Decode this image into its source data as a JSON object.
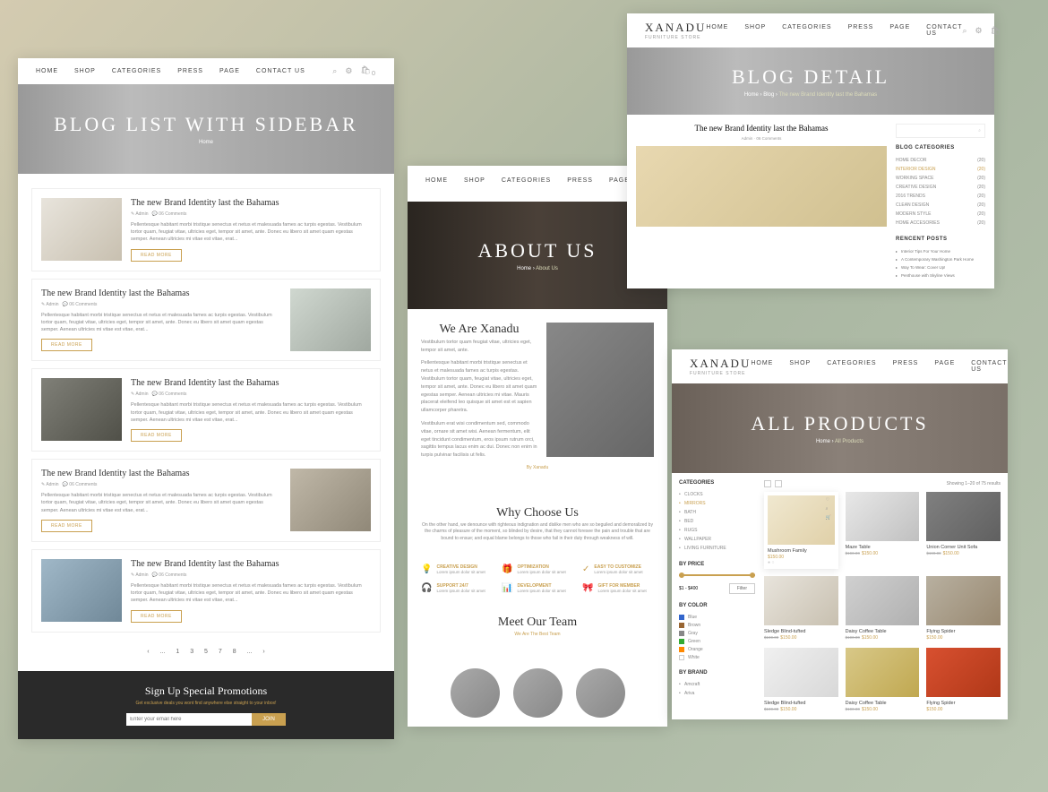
{
  "brand": {
    "name": "XANADU",
    "tagline": "FURNITURE STORE"
  },
  "nav": {
    "home": "HOME",
    "shop": "SHOP",
    "categories": "CATEGORIES",
    "press": "PRESS",
    "page": "PAGE",
    "contact": "CONTACT US",
    "cart_count": "0"
  },
  "p1": {
    "title": "BLOG LIST WITH SIDEBAR",
    "crumb_home": "Home",
    "posts": [
      {
        "title": "The new Brand Identity last the Bahamas",
        "author": "Admin",
        "comments": "06 Comments",
        "excerpt": "Pellentesque habitant morbi tristique senectus et netus et malesuada fames ac turpis egestas. Vestibulum tortor quam, feugiat vitae, ultricies eget, tempor sit amet, ante. Donec eu libero sit amet quam egestas semper. Aenean ultricies mi vitae est vitae, erat...",
        "btn": "READ MORE"
      },
      {
        "title": "The new Brand Identity last the Bahamas",
        "author": "Admin",
        "comments": "06 Comments",
        "excerpt": "Pellentesque habitant morbi tristique senectus et netus et malesuada fames ac turpis egestas. Vestibulum tortor quam, feugiat vitae, ultricies eget, tempor sit amet, ante. Donec eu libero sit amet quam egestas semper. Aenean ultricies mi vitae est vitae, erat...",
        "btn": "READ MORE"
      },
      {
        "title": "The new Brand Identity last the Bahamas",
        "author": "Admin",
        "comments": "06 Comments",
        "excerpt": "Pellentesque habitant morbi tristique senectus et netus et malesuada fames ac turpis egestas. Vestibulum tortor quam, feugiat vitae, ultricies eget, tempor sit amet, ante. Donec eu libero sit amet quam egestas semper. Aenean ultricies mi vitae est vitae, erat...",
        "btn": "READ MORE"
      },
      {
        "title": "The new Brand Identity last the Bahamas",
        "author": "Admin",
        "comments": "06 Comments",
        "excerpt": "Pellentesque habitant morbi tristique senectus et netus et malesuada fames ac turpis egestas. Vestibulum tortor quam, feugiat vitae, ultricies eget, tempor sit amet, ante. Donec eu libero sit amet quam egestas semper. Aenean ultricies mi vitae est vitae, erat...",
        "btn": "READ MORE"
      },
      {
        "title": "The new Brand Identity last the Bahamas",
        "author": "Admin",
        "comments": "06 Comments",
        "excerpt": "Pellentesque habitant morbi tristique senectus et netus et malesuada fames ac turpis egestas. Vestibulum tortor quam, feugiat vitae, ultricies eget, tempor sit amet, ante. Donec eu libero sit amet quam egestas semper. Aenean ultricies mi vitae est vitae, erat...",
        "btn": "READ MORE"
      }
    ],
    "pagination": {
      "prev": "‹",
      "dots": "...",
      "p1": "1",
      "p3": "3",
      "p5": "5",
      "p7": "7",
      "p8": "8",
      "next": "›"
    },
    "signup": {
      "title": "Sign Up Special Promotions",
      "sub": "Get exclusive deals you wont find anywhere else straight to your inbox!",
      "placeholder": "Enter your email here",
      "btn": "JOIN"
    }
  },
  "p2": {
    "title": "ABOUT US",
    "crumb": {
      "home": "Home",
      "current": "About Us"
    },
    "about": {
      "title": "We Are Xanadu",
      "sub": "By Xanadu",
      "text1": "Vestibulum tortor quam feugiat vitae, ultricies eget, tempor sit amet, ante.",
      "text2": "Pellentesque habitant morbi tristique senectus et netus et malesuada fames ac turpis egestas. Vestibulum tortor quam, feugiat vitae, ultricies eget, tempor sit amet, ante. Donec eu libero sit amet quam egestas semper. Aenean ultricies mi vitae. Mauris placerat eleifend leo quisque sit amet est et sapien ullamcorper pharetra.",
      "text3": "Vestibulum erat wisi condimentum sed, commodo vitae, ornare sit amet wisi. Aenean fermentum, elit eget tincidunt condimentum, eros ipsum rutrum orci, sagittis tempus lacus enim ac dui. Donec non enim in turpis pulvinar facilisis ut felis."
    },
    "why": {
      "title": "Why Choose Us",
      "sub": "On the other hand, we denounce with righteous indignation and dislike men who are so beguiled and demoralized by the charms of pleasure of the moment, so blinded by desire, that they cannot foresee the pain and trouble that are bound to ensue; and equal blame belongs to those who fail in their duty through weakness of will."
    },
    "features": [
      {
        "title": "CREATIVE DESIGN",
        "desc": "Lorem ipsum dolor sit amet"
      },
      {
        "title": "OPTIMIZATION",
        "desc": "Lorem ipsum dolor sit amet"
      },
      {
        "title": "EASY TO CUSTOMIZE",
        "desc": "Lorem ipsum dolor sit amet"
      },
      {
        "title": "SUPPORT 24/7",
        "desc": "Lorem ipsum dolor sit amet"
      },
      {
        "title": "DEVELOPMENT",
        "desc": "Lorem ipsum dolor sit amet"
      },
      {
        "title": "GIFT FOR MEMBER",
        "desc": "Lorem ipsum dolor sit amet"
      }
    ],
    "team": {
      "title": "Meet Our Team",
      "sub": "We Are The Best Team"
    }
  },
  "p3": {
    "title": "BLOG DETAIL",
    "crumb": {
      "home": "Home",
      "blog": "Blog",
      "current": "The new Brand Identity last the Bahamas"
    },
    "post": {
      "title": "The new Brand Identity last the Bahamas",
      "meta": "Admin · 06 Comments"
    },
    "side": {
      "cat_title": "BLOG CATEGORIES",
      "cats": [
        {
          "name": "HOME DECOR",
          "count": "(20)"
        },
        {
          "name": "INTERIOR DESIGN",
          "count": "(20)"
        },
        {
          "name": "WORKING SPACE",
          "count": "(20)"
        },
        {
          "name": "CREATIVE DESIGN",
          "count": "(20)"
        },
        {
          "name": "2016 TRENDS",
          "count": "(20)"
        },
        {
          "name": "CLEAN DESIGN",
          "count": "(20)"
        },
        {
          "name": "MODERN STYLE",
          "count": "(20)"
        },
        {
          "name": "HOME ACCESORIES",
          "count": "(20)"
        }
      ],
      "recent_title": "RENCENT POSTS",
      "recent": [
        "Interior Tips For Your Home",
        "A Contemporary Washington Park Home",
        "Way To Wear: Cover Up!",
        "Penthouse with Skyline Views"
      ]
    }
  },
  "p4": {
    "title": "ALL PRODUCTS",
    "crumb": {
      "home": "Home",
      "current": "All Products"
    },
    "side": {
      "cat_title": "CATEGORIES",
      "cats": [
        "CLOCKS",
        "MIRRORS",
        "BATH",
        "BED",
        "RUGS",
        "WALLPAPER",
        "LIVING FURNITURE"
      ],
      "price_title": "BY PRICE",
      "price_range": "$1 - $400",
      "filter_btn": "Filter",
      "color_title": "BY COLOR",
      "colors": [
        "Blue",
        "Brown",
        "Gray",
        "Green",
        "Orange",
        "White"
      ],
      "brand_title": "BY BRAND",
      "brands": [
        "Amcraft",
        "Ariva"
      ]
    },
    "toolbar": {
      "results": "Showing 1–20 of 75 results"
    },
    "products": [
      {
        "name": "Mushroom Family",
        "price": "$150.00"
      },
      {
        "name": "Maze Table",
        "old": "$190.00",
        "price": "$150.00"
      },
      {
        "name": "Union Corner Unit Sofa",
        "old": "$190.00",
        "price": "$150.00"
      },
      {
        "name": "Sledge Blind-tufted",
        "old": "$190.00",
        "price": "$150.00"
      },
      {
        "name": "Daisy Coffee Table",
        "old": "$190.00",
        "price": "$150.00"
      },
      {
        "name": "Flying Spider",
        "price": "$150.00"
      },
      {
        "name": "Sledge Blind-tufted",
        "old": "$190.00",
        "price": "$150.00"
      },
      {
        "name": "Daisy Coffee Table",
        "old": "$190.00",
        "price": "$150.00"
      },
      {
        "name": "Flying Spider",
        "price": "$150.00"
      }
    ]
  }
}
